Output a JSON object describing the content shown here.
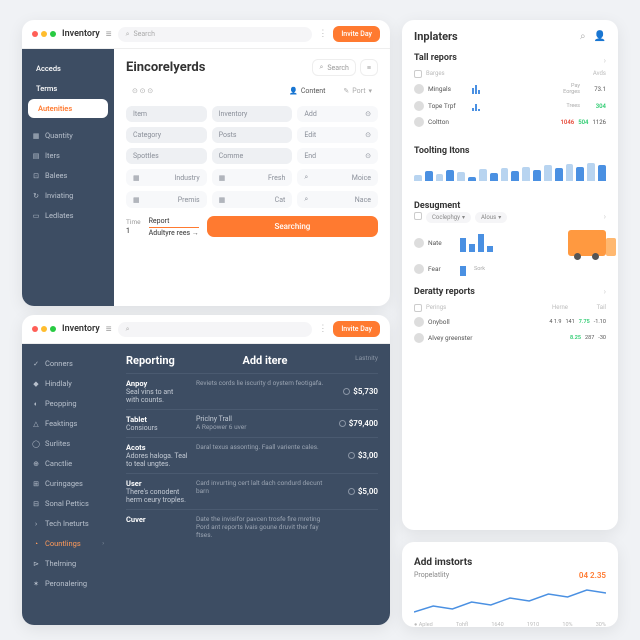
{
  "brand": "Inventory",
  "search_placeholder": "Search",
  "header_btn": "Invite Day",
  "panel1": {
    "side_top": [
      "Acceds",
      "Terms"
    ],
    "side_active": "Autenities",
    "side_items": [
      {
        "icon": "▦",
        "label": "Quantity"
      },
      {
        "icon": "▤",
        "label": "Iters"
      },
      {
        "icon": "⊡",
        "label": "Balees"
      },
      {
        "icon": "↻",
        "label": "Inviating"
      },
      {
        "icon": "▭",
        "label": "Ledlates"
      }
    ],
    "title": "Eincorelyerds",
    "search_label": "Search",
    "tab1": "Content",
    "tab2": "Port",
    "grid": [
      [
        "Item",
        "Inventory",
        "Add"
      ],
      [
        "Category",
        "Posts",
        "Edit"
      ],
      [
        "Spottles",
        "Comme",
        "End"
      ],
      [
        "Industry",
        "Fresh",
        "Moice"
      ],
      [
        "Premis",
        "Cat",
        "Nace"
      ]
    ],
    "foot_time": "Time",
    "foot_time_v": "1",
    "foot_rep": "Report",
    "foot_rep_v": "Adultyre rees",
    "foot_btn": "Searching"
  },
  "panel2": {
    "side": [
      {
        "icon": "✓",
        "label": "Conners"
      },
      {
        "icon": "◆",
        "label": "Hindlaly"
      },
      {
        "icon": "◐",
        "label": "Peopping"
      },
      {
        "icon": "△",
        "label": "Feaktings"
      },
      {
        "icon": "◯",
        "label": "Surlites"
      },
      {
        "icon": "⊕",
        "label": "Canctlie"
      },
      {
        "icon": "⊞",
        "label": "Curingages"
      },
      {
        "icon": "⊟",
        "label": "Sonal Pettics"
      },
      {
        "icon": "›",
        "label": "Tech Ineturts"
      },
      {
        "icon": "◔",
        "label": "Countlings"
      },
      {
        "icon": "⊳",
        "label": "Thelrning"
      },
      {
        "icon": "✶",
        "label": "Peronalering"
      }
    ],
    "t1": "Reporting",
    "t2": "Add itere",
    "t3": "Lastnity",
    "rows": [
      {
        "h": "Anpoy",
        "s": "Seal vins to ant with counts.",
        "d": "Reviets cords lie iscurity d oystem feotigafa.",
        "v": "$5,730"
      },
      {
        "h": "Tablet",
        "s": "Consiours",
        "d": "A Repower    6 uver",
        "v": "$79,400",
        "sub": "Priclny        Trall"
      },
      {
        "h": "Acots",
        "s": "Adores haloga. Teal to teal ungtes.",
        "d": "Daral texus assonting. Faall variente cales.",
        "v": "$3,00"
      },
      {
        "h": "User",
        "s": "There's conodent herm ceury troples.",
        "d": "Card invurting cert lalt dach condurd decunt barn",
        "v": "$5,00"
      },
      {
        "h": "Cuver",
        "s": "",
        "d": "Date the invisifor pavcen trosfe fire mreting Pord ant reports lvais goune druvit ther fay ftses.",
        "v": ""
      }
    ]
  },
  "panel3": {
    "title": "Inplaters",
    "s1": {
      "title": "Tall repors",
      "h1": "Barges",
      "h2": "Avds",
      "rows": [
        {
          "n": "Mingals",
          "bars": [
            6,
            9,
            4
          ],
          "c1": "Pay",
          "c2": "73.1"
        },
        {
          "n": "Tope Trpf",
          "bars": [
            3,
            7,
            2
          ],
          "c1": "Eorges",
          "c2": "304",
          "c1b": "Trees"
        },
        {
          "n": "Coltton",
          "vals": [
            "1046",
            "504",
            "1126"
          ]
        }
      ]
    },
    "s2": {
      "title": "Toolting Itons",
      "bars": [
        5,
        9,
        6,
        10,
        8,
        4,
        11,
        7,
        12,
        9,
        13,
        10,
        14,
        12,
        15,
        13,
        16,
        14
      ]
    },
    "s3": {
      "title": "Desugment",
      "pill1": "Coclephgy",
      "pill2": "Alous",
      "rows": [
        {
          "n": "Nate",
          "bars": [
            14,
            8,
            18,
            6
          ]
        },
        {
          "n": "Fear",
          "bars": [
            10
          ],
          "tag": "Sork"
        }
      ]
    },
    "s4": {
      "title": "Deratty reports",
      "h1": "Perings",
      "h2": "Herne",
      "h3": "Tail",
      "rows": [
        {
          "n": "Onyboll",
          "a": "4 1.9",
          "b": "141",
          "c": "7.75",
          "d": "-1.10"
        },
        {
          "n": "Alvey greenster",
          "a": "",
          "b": "8.25",
          "c": "287",
          "d": "-30"
        }
      ]
    }
  },
  "panel4": {
    "title": "Add imstorts",
    "sub": "Propelatlity",
    "val": "04 2.35",
    "legend": [
      "Apled",
      "Tohfl",
      "1640",
      "1910",
      "10%",
      "30%"
    ]
  },
  "chart_data": [
    {
      "type": "bar",
      "title": "Toolting Itons",
      "values": [
        5,
        9,
        6,
        10,
        8,
        4,
        11,
        7,
        12,
        9,
        13,
        10,
        14,
        12,
        15,
        13,
        16,
        14
      ],
      "ylim": [
        0,
        18
      ]
    },
    {
      "type": "bar",
      "title": "Desugment Nate",
      "values": [
        14,
        8,
        18,
        6
      ],
      "ylim": [
        0,
        20
      ]
    },
    {
      "type": "line",
      "title": "Propelatlity",
      "x": [
        "Apled",
        "Tohfl",
        "1640",
        "1910",
        "10%",
        "30%"
      ],
      "values": [
        8,
        12,
        10,
        14,
        11,
        18,
        15,
        22,
        19,
        26
      ],
      "ylim": [
        0,
        30
      ]
    }
  ]
}
